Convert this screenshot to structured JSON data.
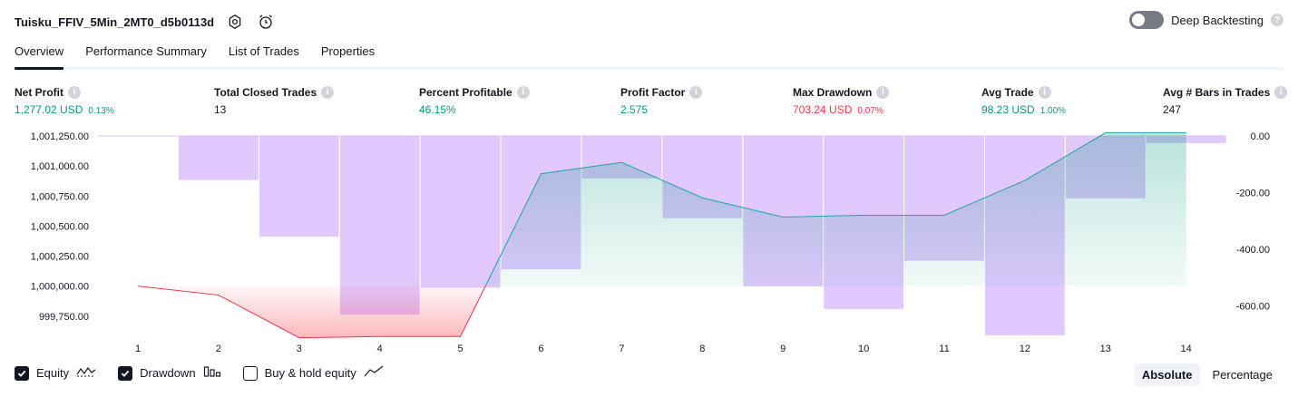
{
  "header": {
    "title": "Tuisku_FFIV_5Min_2MT0_d5b0113d",
    "deep_backtesting_label": "Deep Backtesting"
  },
  "tabs": [
    {
      "label": "Overview",
      "active": true
    },
    {
      "label": "Performance Summary",
      "active": false
    },
    {
      "label": "List of Trades",
      "active": false
    },
    {
      "label": "Properties",
      "active": false
    }
  ],
  "metrics": {
    "net_profit": {
      "label": "Net Profit",
      "value": "1,277.02 USD",
      "pct": "0.13%"
    },
    "total_closed_trades": {
      "label": "Total Closed Trades",
      "value": "13"
    },
    "percent_profitable": {
      "label": "Percent Profitable",
      "value": "46.15%"
    },
    "profit_factor": {
      "label": "Profit Factor",
      "value": "2.575"
    },
    "max_drawdown": {
      "label": "Max Drawdown",
      "value": "703.24 USD",
      "pct": "0.07%"
    },
    "avg_trade": {
      "label": "Avg Trade",
      "value": "98.23 USD",
      "pct": "1.00%"
    },
    "avg_bars": {
      "label": "Avg # Bars in Trades",
      "value": "247"
    }
  },
  "chart_data": {
    "type": "line",
    "x": [
      1,
      2,
      3,
      4,
      5,
      6,
      7,
      8,
      9,
      10,
      11,
      12,
      13,
      14
    ],
    "x_tick_labels": [
      "1",
      "2",
      "3",
      "4",
      "5",
      "6",
      "7",
      "8",
      "9",
      "10",
      "11",
      "12",
      "13",
      "14"
    ],
    "left_axis": {
      "ticks": [
        "1,001,250.00",
        "1,001,000.00",
        "1,000,750.00",
        "1,000,500.00",
        "1,000,250.00",
        "1,000,000.00",
        "999,750.00"
      ],
      "ylim": [
        999650,
        1001250
      ]
    },
    "right_axis": {
      "ticks": [
        "0.00",
        "-200.00",
        "-400.00",
        "-600.00"
      ],
      "ylim": [
        -700,
        0
      ]
    },
    "series": [
      {
        "name": "Equity",
        "axis": "left",
        "values": [
          1000000,
          999925,
          999570,
          999580,
          999580,
          1000935,
          1001030,
          1000735,
          1000575,
          1000590,
          1000590,
          1000880,
          1001277,
          1001277
        ]
      },
      {
        "name": "Drawdown",
        "axis": "right",
        "values": [
          0,
          -155,
          -355,
          -630,
          -535,
          -470,
          -150,
          -290,
          -530,
          -610,
          -440,
          -703,
          -220,
          -25
        ]
      }
    ],
    "grid": "vertical"
  },
  "legend": [
    {
      "label": "Equity",
      "checked": true,
      "icon": "equity-wave-icon"
    },
    {
      "label": "Drawdown",
      "checked": true,
      "icon": "drawdown-bars-icon"
    },
    {
      "label": "Buy & hold equity",
      "checked": false,
      "icon": "trend-line-icon"
    }
  ],
  "view_toggle": {
    "absolute": "Absolute",
    "percentage": "Percentage",
    "selected": "absolute"
  },
  "colors": {
    "green": "#089981",
    "red": "#f23645",
    "drawdown_bar": "#dcbefd",
    "equity_line": "#22a3a9",
    "loss_line": "#f23645"
  }
}
